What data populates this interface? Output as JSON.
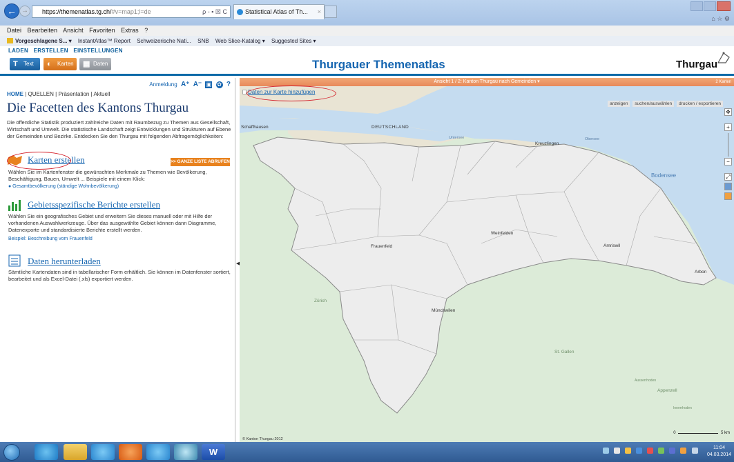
{
  "browser": {
    "url_host": "https://themenatlas.tg.ch/",
    "url_rest": "#v=map1;l=de",
    "url_icons": "ρ - ▪ ☒ C",
    "tab_title": "Statistical Atlas of Th...",
    "tab_close": "×",
    "back_glyph": "←",
    "forward_glyph": "→"
  },
  "menubar": [
    "Datei",
    "Bearbeiten",
    "Ansicht",
    "Favoriten",
    "Extras",
    "?"
  ],
  "favbar": [
    "Vorgeschlagene S... ▾",
    "InstantAtlas™ Report",
    "Schweizerische Nati...",
    "SNB",
    "Web Slice-Katalog ▾",
    "Suggested Sites ▾"
  ],
  "app": {
    "menu": [
      "LADEN",
      "ERSTELLEN",
      "EINSTELLUNGEN"
    ],
    "btn_text": "Text",
    "btn_karten": "Karten",
    "btn_daten": "Daten",
    "title": "Thurgauer Themenatlas",
    "logo": "Thurgau"
  },
  "left": {
    "tools": {
      "login": "Anmeldung",
      "font_big": "A⁺",
      "font_small": "A⁻",
      "q": "?"
    },
    "nav": {
      "home": "HOME",
      "sep": "|",
      "quellen": "QUELLEN",
      "praes": "Präsentation",
      "aktuell": "Aktuell"
    },
    "page_title": "Die Facetten des Kantons Thurgau",
    "intro": "Die öffentliche Statistik produziert zahlreiche Daten mit Raumbezug zu Themen aus Gesellschaft, Wirtschaft und Umwelt. Die statistische Landschaft zeigt Entwicklungen und Strukturen auf Ebene der Gemeinden und Bezirke. Entdecken Sie den Thurgau mit folgenden Abfragemöglichkeiten:",
    "sec1": {
      "title": "Karten erstellen",
      "button": ">> GANZE LISTE ABRUFEN",
      "text": "Wählen Sie im Kartenfenster die gewünschten Merkmale zu Themen wie Bevölkerung, Beschäftigung, Bauen, Umwelt ... Beispiele mit einem Klick:",
      "link": "● Gesamtbevölkerung (ständige Wohnbevölkerung)"
    },
    "sec2": {
      "title": "Gebietsspezifische Berichte erstellen",
      "text": "Wählen Sie ein geografisches Gebiet und erweitern Sie dieses manuell oder mit Hilfe der vorhandenen Auswahlwerkzeuge. Über das ausgewählte Gebiet können dann Diagramme, Datenexporte und standardisierte Berichte erstellt werden.",
      "link": "Beispiel: Beschreibung vom Frauenfeld"
    },
    "sec3": {
      "title": "Daten herunterladen",
      "text": "Sämtliche Kartendaten sind in tabellarischer Form erhältlich. Sie können im Datenfenster sortiert, bearbeitet und als Excel-Datei (.xls) exportiert werden."
    }
  },
  "map": {
    "header": "Ansicht 1 / 2: Kanton Thurgau nach Gemeinden ▾",
    "header_right": "2 Karten",
    "add_data": "Daten zur Karte hinzufügen",
    "tools": [
      "anzeigen",
      "suchen/auswählen",
      "drucken / exportieren"
    ],
    "labels": {
      "schaffhausen": "Schaffhausen",
      "deutschland": "DEUTSCHLAND",
      "untersee": "Untersee",
      "obersee": "Obersee",
      "bodensee": "Bodensee",
      "kreuzlingen": "Kreuzlingen",
      "weinfelden": "Weinfelden",
      "frauenfeld": "Frauenfeld",
      "amriswil": "Amriswil",
      "arbon": "Arbon",
      "zuerich": "Zürich",
      "muenchwilen": "Münchwilen",
      "stgallen": "St. Gallen",
      "appenzell": "Appenzell",
      "ausserrhoden": "Ausserrhoden",
      "innerrhoden": "Innerrhoden"
    },
    "copyright": "© Kanton Thurgau 2012",
    "scale_0": "0",
    "scale_5": "5 km",
    "zoom_plus": "+",
    "zoom_minus": "−"
  },
  "taskbar": {
    "time": "11:04",
    "date": "04.03.2014"
  },
  "colors": {
    "accent": "#1565b0",
    "orange": "#e8821e",
    "lake": "#c5dcf0",
    "canton": "#ededed",
    "neighbor": "#dcebd8",
    "germany": "#e9e4d4"
  }
}
